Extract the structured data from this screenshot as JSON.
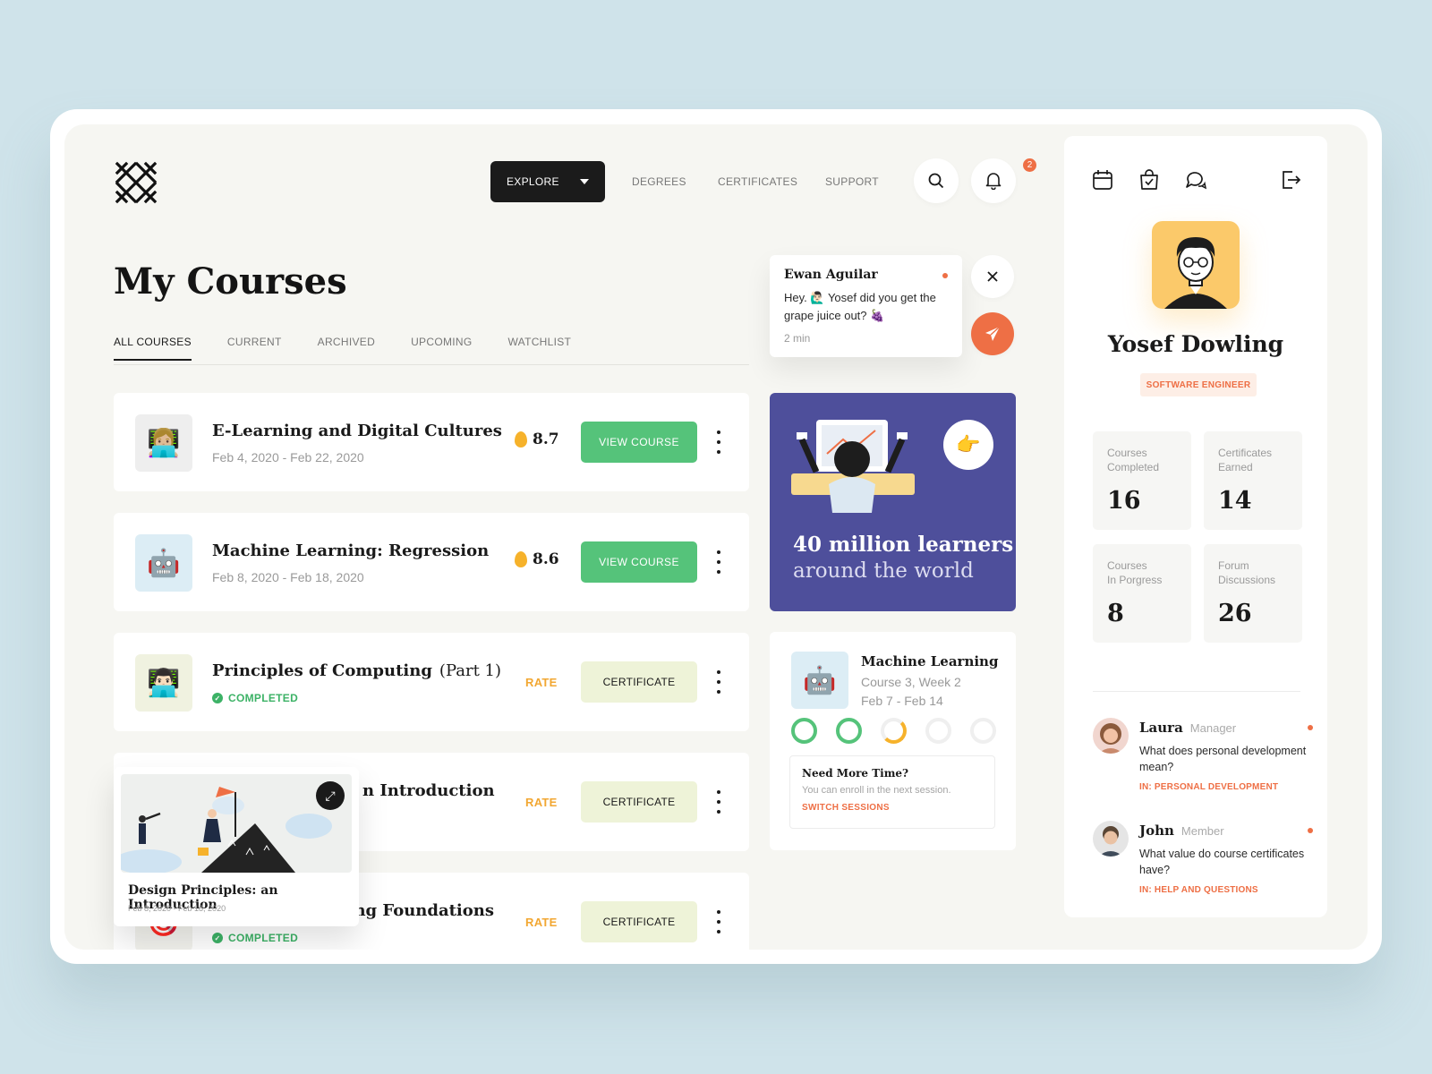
{
  "nav": {
    "explore_label": "EXPLORE",
    "links": [
      "DEGREES",
      "CERTIFICATES",
      "SUPPORT"
    ],
    "notification_count": "2"
  },
  "page_title": "My Courses",
  "tabs": [
    "ALL COURSES",
    "CURRENT",
    "ARCHIVED",
    "UPCOMING",
    "WATCHLIST"
  ],
  "courses": [
    {
      "title": "E-Learning and Digital Cultures",
      "date": "Feb 4, 2020 - Feb 22, 2020",
      "rating": "8.7",
      "action": "VIEW COURSE"
    },
    {
      "title": "Machine Learning: Regression",
      "date": "Feb 8, 2020 - Feb 18, 2020",
      "rating": "8.6",
      "action": "VIEW COURSE"
    },
    {
      "title": "Principles of Computing",
      "part": "(Part 1)",
      "status": "COMPLETED",
      "rate": "RATE",
      "action": "CERTIFICATE"
    },
    {
      "title_visible": "n Introduction",
      "rate": "RATE",
      "action": "CERTIFICATE"
    },
    {
      "title_visible": "Machine Learning Foundations",
      "status": "COMPLETED",
      "rate": "RATE",
      "action": "CERTIFICATE"
    }
  ],
  "popup_course": {
    "title": "Design Principles: an Introduction",
    "date": "Feb 8, 2020 - Feb 18, 2020"
  },
  "chat": {
    "name": "Ewan Aguilar",
    "message": "Hey. 🙋🏻‍♂️ Yosef did you get the grape juice out? 🍇",
    "time": "2 min"
  },
  "promo": {
    "line1": "40 million learners",
    "line2": "around the world",
    "pointer_emoji": "👉"
  },
  "progress": {
    "title": "Machine Learning",
    "course_week": "Course 3, Week 2",
    "dates": "Feb 7 - Feb 14",
    "need_title": "Need More Time?",
    "need_sub": "You can enroll in the next session.",
    "need_link": "SWITCH SESSIONS"
  },
  "profile": {
    "name": "Yosef Dowling",
    "role": "SOFTWARE ENGINEER",
    "stats": [
      {
        "label1": "Courses",
        "label2": "Completed",
        "value": "16"
      },
      {
        "label1": "Certificates",
        "label2": "Earned",
        "value": "14"
      },
      {
        "label1": "Courses",
        "label2": "In Porgress",
        "value": "8"
      },
      {
        "label1": "Forum",
        "label2": "Discussions",
        "value": "26"
      }
    ]
  },
  "forum": [
    {
      "name": "Laura",
      "role": "Manager",
      "question": "What does personal development mean?",
      "tag": "IN: PERSONAL DEVELOPMENT"
    },
    {
      "name": "John",
      "role": "Member",
      "question": "What value do course certificates have?",
      "tag": "IN: HELP AND QUESTIONS"
    }
  ],
  "colors": {
    "accent": "#ee6f45",
    "green": "#55c37a",
    "purple": "#4e4f9b",
    "yellow": "#f6b22b"
  },
  "icons": [
    "logo-icon",
    "search-icon",
    "bell-icon",
    "close-icon",
    "send-icon",
    "calendar-icon",
    "bag-icon",
    "chat-icon",
    "logout-icon",
    "expand-icon",
    "flame-icon"
  ]
}
